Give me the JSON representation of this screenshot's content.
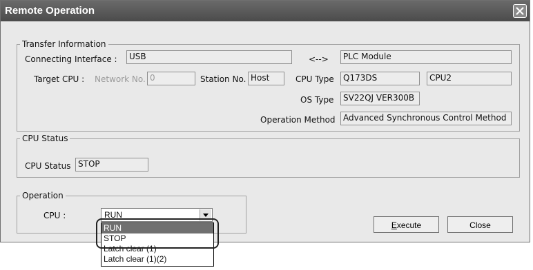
{
  "window": {
    "title": "Remote Operation"
  },
  "transfer": {
    "legend": "Transfer Information",
    "connecting_interface_label": "Connecting Interface :",
    "connecting_interface_value": "USB",
    "arrow": "<-->",
    "plc_module_value": "PLC Module",
    "target_cpu_label": "Target CPU :",
    "network_no_label": "Network No.",
    "network_no_value": "0",
    "station_no_label": "Station No.",
    "station_no_value": "Host",
    "cpu_type_label": "CPU Type",
    "cpu_type_value": "Q173DS",
    "cpu_no_value": "CPU2",
    "os_type_label": "OS Type",
    "os_type_value": "SV22QJ VER300B",
    "operation_method_label": "Operation Method",
    "operation_method_value": "Advanced Synchronous Control Method"
  },
  "cpu_status": {
    "legend": "CPU Status",
    "label": "CPU Status",
    "value": "STOP"
  },
  "operation": {
    "legend": "Operation",
    "cpu_label": "CPU :",
    "selected": "RUN",
    "options": [
      "RUN",
      "STOP",
      "Latch clear (1)",
      "Latch clear (1)(2)"
    ]
  },
  "buttons": {
    "execute": "Execute",
    "close": "Close"
  }
}
